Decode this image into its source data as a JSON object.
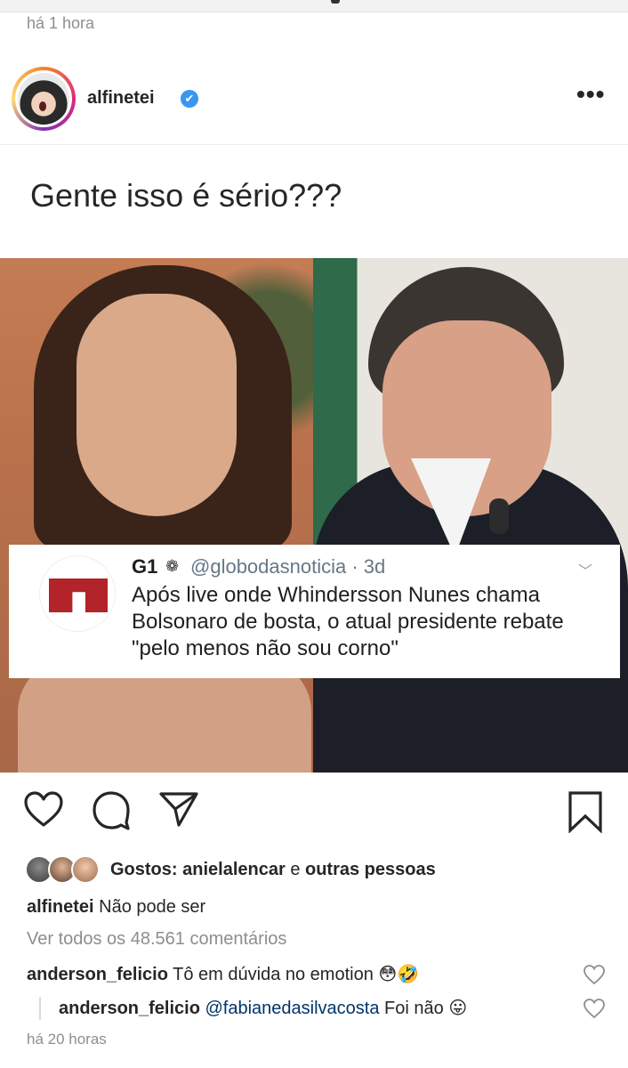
{
  "previous_post": {
    "time": "há 1 hora"
  },
  "header": {
    "username": "alfinetei",
    "verified_glyph": "✔",
    "more_glyph": "•••"
  },
  "post": {
    "caption_overlay": "Gente isso é sério???",
    "tweet": {
      "name": "G1",
      "badge_glyph": "❁",
      "handle_time": "@globodasnoticia · 3d",
      "text": "Após live onde Whindersson Nunes chama Bolsonaro de bosta, o atual presidente rebate \"pelo menos não sou corno\"",
      "caret": "﹀"
    }
  },
  "actions": {
    "icons": [
      "heart-icon",
      "comment-icon",
      "share-icon",
      "bookmark-icon"
    ]
  },
  "likes": {
    "prefix": "Gostos:",
    "first_user": "anielalencar",
    "connector": "e",
    "others": "outras pessoas"
  },
  "caption": {
    "username": "alfinetei",
    "text": "Não pode ser"
  },
  "view_all_comments": "Ver todos os 48.561 comentários",
  "comments": [
    {
      "username": "anderson_felicio",
      "text": "Tô em dúvida no emotion",
      "emoji": "😳🤣"
    },
    {
      "username": "anderson_felicio",
      "mention": "@fabianedasilvacosta",
      "text": "Foi não",
      "emoji": "😛"
    }
  ],
  "timestamp": "há 20 horas",
  "colors": {
    "verified": "#3897f0",
    "muted": "#8e8e8e",
    "mention": "#003569",
    "g1_red": "#b2232a"
  }
}
